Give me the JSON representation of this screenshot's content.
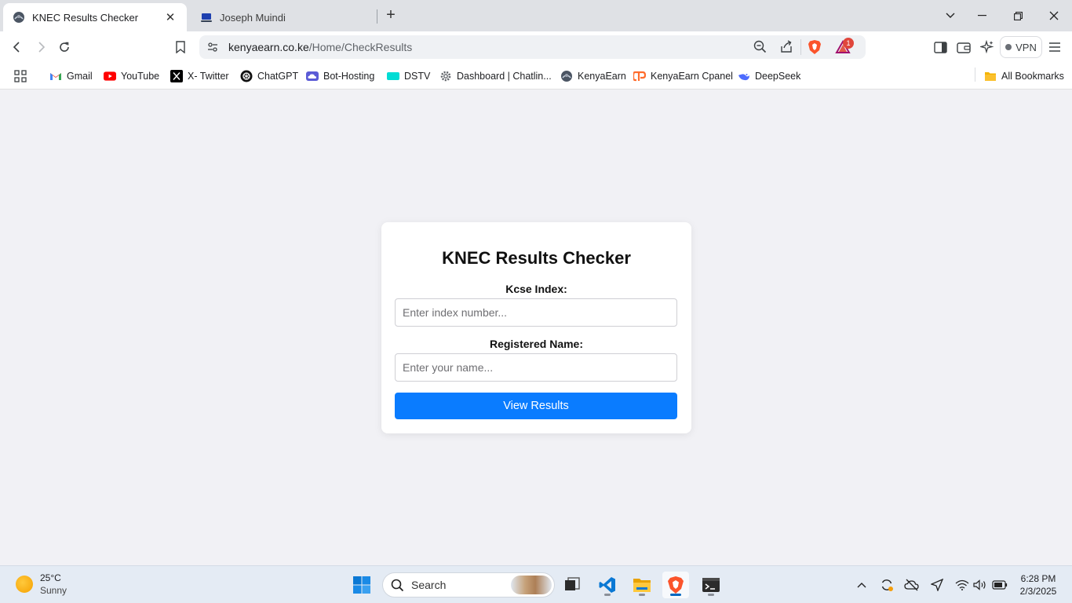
{
  "browser": {
    "tabs": [
      {
        "title": "KNEC Results Checker",
        "active": true
      },
      {
        "title": "Joseph Muindi",
        "active": false
      }
    ],
    "url_host": "kenyaearn.co.ke",
    "url_path": "/Home/CheckResults",
    "vpn_label": "VPN",
    "rewards_badge": "1",
    "accent_color": "#fb542b"
  },
  "bookmarks": {
    "items": [
      {
        "label": "Gmail",
        "icon": "gmail-icon"
      },
      {
        "label": "YouTube",
        "icon": "youtube-icon"
      },
      {
        "label": "X- Twitter",
        "icon": "x-twitter-icon"
      },
      {
        "label": "ChatGPT",
        "icon": "chatgpt-icon"
      },
      {
        "label": "Bot-Hosting",
        "icon": "cloud-icon"
      },
      {
        "label": "DSTV",
        "icon": "dstv-icon"
      },
      {
        "label": "Dashboard | Chatlin...",
        "icon": "gear-icon"
      },
      {
        "label": "KenyaEarn",
        "icon": "kenyaearn-icon"
      },
      {
        "label": "KenyaEarn Cpanel",
        "icon": "cpanel-icon"
      },
      {
        "label": "DeepSeek",
        "icon": "deepseek-icon"
      }
    ],
    "all_bookmarks": "All Bookmarks"
  },
  "form": {
    "title": "KNEC Results Checker",
    "index_label": "Kcse Index:",
    "index_placeholder": "Enter index number...",
    "index_value": "",
    "name_label": "Registered Name:",
    "name_placeholder": "Enter your name...",
    "name_value": "",
    "submit_label": "View Results",
    "button_color": "#0a7cff"
  },
  "taskbar": {
    "weather_temp": "25°C",
    "weather_condition": "Sunny",
    "search_label": "Search",
    "time": "6:28 PM",
    "date": "2/3/2025"
  }
}
